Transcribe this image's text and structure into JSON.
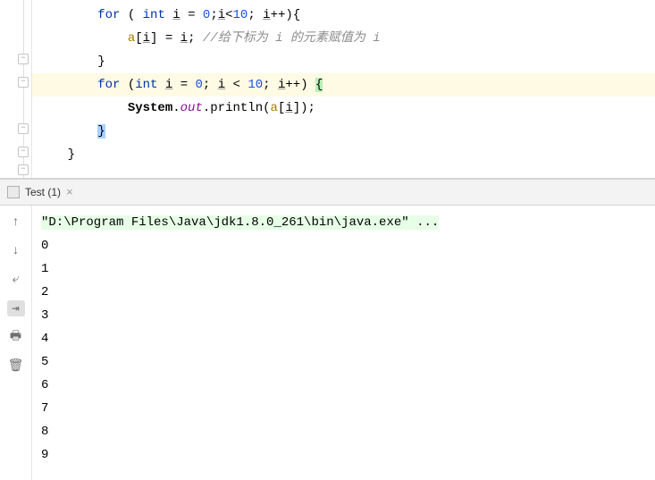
{
  "code": {
    "kw_for": "for",
    "kw_int": "int",
    "var_i": "i",
    "arr_a": "a",
    "num_0": "0",
    "num_10": "10",
    "op_pp": "++",
    "op_lt": "<",
    "op_le": "<",
    "op_asg": "=",
    "semi": ";",
    "comment1": "//给下标为 i 的元素赋值为 i",
    "brace_o": "{",
    "brace_c": "}",
    "sys": "System",
    "out": "out",
    "println": "println",
    "dot": ".",
    "lpar": "(",
    "rpar": ")",
    "lbrk": "[",
    "rbrk": "]",
    "space1": "        ",
    "space2": "            ",
    "space3": "    "
  },
  "tab": {
    "title": "Test (1)"
  },
  "console": {
    "command": "\"D:\\Program Files\\Java\\jdk1.8.0_261\\bin\\java.exe\" ...",
    "out0": "0",
    "out1": "1",
    "out2": "2",
    "out3": "3",
    "out4": "4",
    "out5": "5",
    "out6": "6",
    "out7": "7",
    "out8": "8",
    "out9": "9"
  },
  "icons": {
    "up": "↑",
    "down": "↓",
    "wrap": "⤶",
    "scroll": "⇥",
    "print": "🖶",
    "trash": "🗑",
    "close": "×"
  },
  "fold": {
    "sym": "−"
  }
}
